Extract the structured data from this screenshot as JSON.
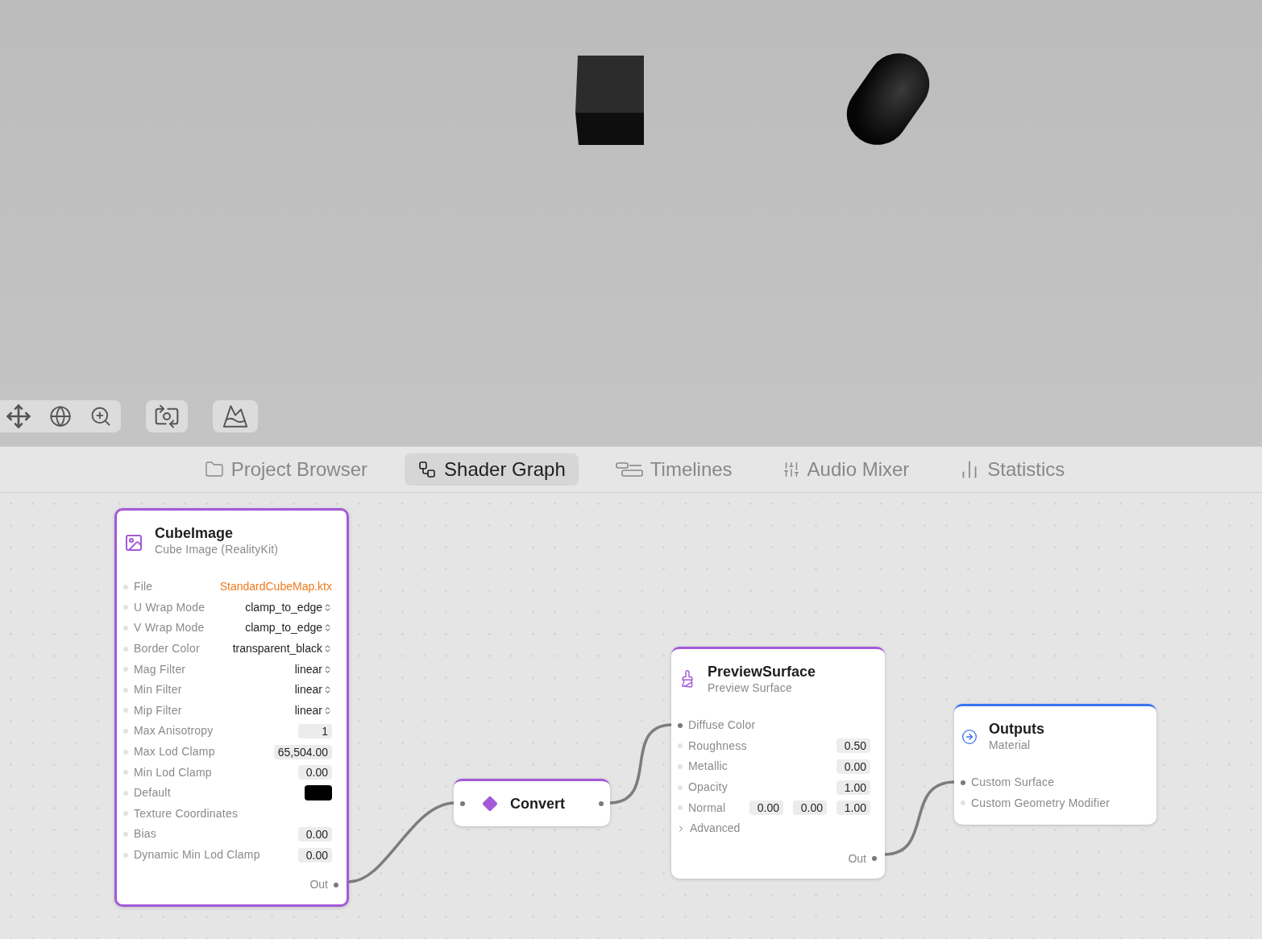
{
  "tabs": [
    {
      "label": "Project Browser",
      "selected": false
    },
    {
      "label": "Shader Graph",
      "selected": true
    },
    {
      "label": "Timelines",
      "selected": false
    },
    {
      "label": "Audio Mixer",
      "selected": false
    },
    {
      "label": "Statistics",
      "selected": false
    }
  ],
  "nodes": [
    {
      "kind": "full",
      "title": "CubeImage",
      "subtitle": "Cube Image (RealityKit)",
      "color": "#a35ad8",
      "selected": true,
      "inputs": [
        {
          "label": "File",
          "kind": "file",
          "value": "StandardCubeMap.ktx",
          "connected": false
        },
        {
          "label": "U Wrap Mode",
          "kind": "select",
          "value": "clamp_to_edge",
          "connected": false
        },
        {
          "label": "V Wrap Mode",
          "kind": "select",
          "value": "clamp_to_edge",
          "connected": false
        },
        {
          "label": "Border Color",
          "kind": "select",
          "value": "transparent_black",
          "connected": false
        },
        {
          "label": "Mag Filter",
          "kind": "select",
          "value": "linear",
          "connected": false
        },
        {
          "label": "Min Filter",
          "kind": "select",
          "value": "linear",
          "connected": false
        },
        {
          "label": "Mip Filter",
          "kind": "select",
          "value": "linear",
          "connected": false
        },
        {
          "label": "Max Anisotropy",
          "kind": "number",
          "values": [
            "1"
          ],
          "connected": false
        },
        {
          "label": "Max Lod Clamp",
          "kind": "number",
          "values": [
            "65,504.00"
          ],
          "connected": false
        },
        {
          "label": "Min Lod Clamp",
          "kind": "number",
          "values": [
            "0.00"
          ],
          "connected": false
        },
        {
          "label": "Default",
          "kind": "color",
          "color": "#000000",
          "connected": false
        },
        {
          "label": "Texture Coordinates",
          "kind": "plain",
          "connected": false
        },
        {
          "label": "Bias",
          "kind": "number",
          "values": [
            "0.00"
          ],
          "connected": false
        },
        {
          "label": "Dynamic Min Lod Clamp",
          "kind": "number",
          "values": [
            "0.00"
          ],
          "connected": false
        }
      ],
      "output": "Out"
    },
    {
      "kind": "compact",
      "title": "Convert",
      "color": "#a35ad8",
      "selected": false
    },
    {
      "kind": "full",
      "title": "PreviewSurface",
      "subtitle": "Preview Surface",
      "color": "#a35ad8",
      "selected": false,
      "inputs": [
        {
          "label": "Diffuse Color",
          "kind": "plain",
          "connected": true
        },
        {
          "label": "Roughness",
          "kind": "number",
          "values": [
            "0.50"
          ],
          "connected": false
        },
        {
          "label": "Metallic",
          "kind": "number",
          "values": [
            "0.00"
          ],
          "connected": false
        },
        {
          "label": "Opacity",
          "kind": "number",
          "values": [
            "1.00"
          ],
          "connected": false
        },
        {
          "label": "Normal",
          "kind": "number",
          "values": [
            "0.00",
            "0.00",
            "1.00"
          ],
          "connected": false
        },
        {
          "label": "Advanced",
          "kind": "disclosure",
          "expanded": false
        }
      ],
      "output": "Out"
    },
    {
      "kind": "full",
      "title": "Outputs",
      "subtitle": "Material",
      "color": "#3b74f0",
      "selected": false,
      "inputs": [
        {
          "label": "Custom Surface",
          "kind": "plain",
          "connected": true
        },
        {
          "label": "Custom Geometry Modifier",
          "kind": "plain",
          "connected": false
        }
      ]
    }
  ]
}
